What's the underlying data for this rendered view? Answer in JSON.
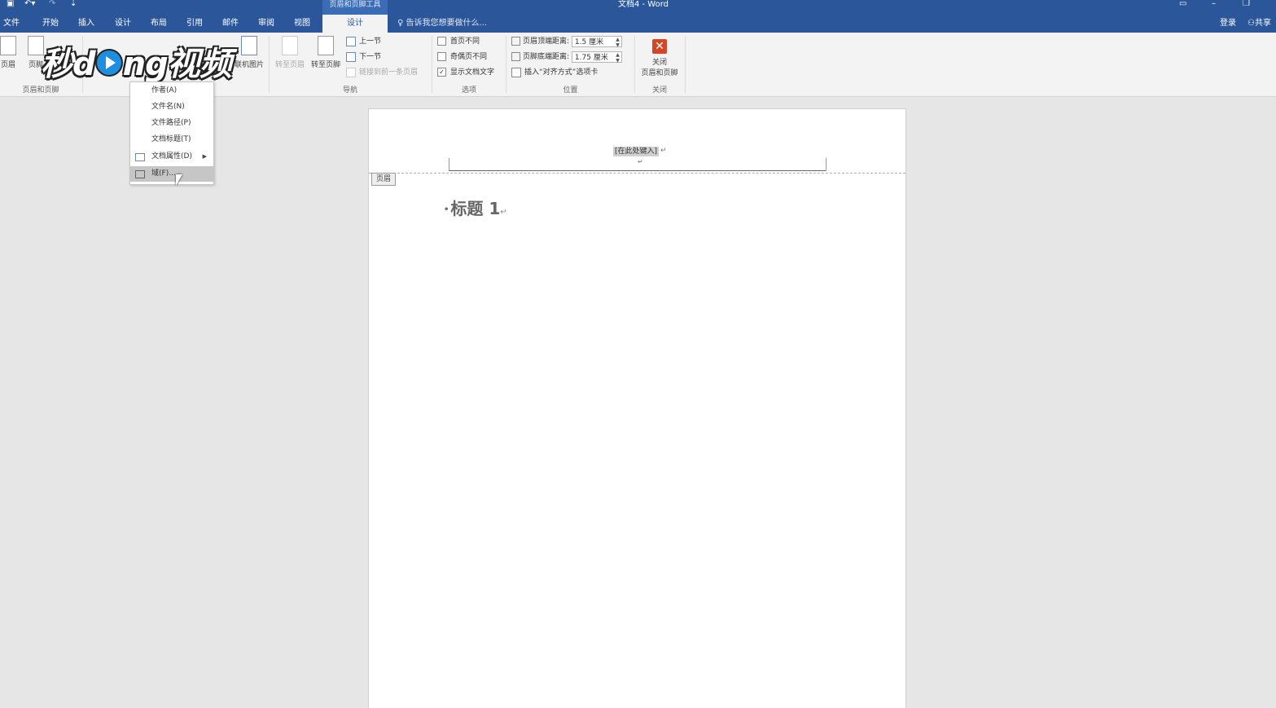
{
  "window": {
    "title": "文档4 - Word",
    "context_tab_group": "页眉和页脚工具",
    "qat": {
      "save_icon": "save-icon",
      "undo_icon": "undo-icon",
      "redo_icon": "redo-icon",
      "customize_icon": "customize-qat-icon"
    }
  },
  "tabs": [
    {
      "label": "文件"
    },
    {
      "label": "开始"
    },
    {
      "label": "插入"
    },
    {
      "label": "设计"
    },
    {
      "label": "布局"
    },
    {
      "label": "引用"
    },
    {
      "label": "邮件"
    },
    {
      "label": "审阅"
    },
    {
      "label": "视图"
    },
    {
      "label": "设计",
      "active": true
    }
  ],
  "tell_me": "告诉我您想要做什么...",
  "signin": "登录",
  "share": "共享",
  "ribbon": {
    "group_header_footer": {
      "label": "页眉和页脚",
      "header": "页眉",
      "footer": "页脚"
    },
    "online_pictures": "联机图片",
    "navigation": {
      "label": "导航",
      "goto_header": "转至页眉",
      "goto_footer": "转至页脚",
      "prev": "上一节",
      "next": "下一节",
      "link_prev": "链接到前一条页眉"
    },
    "options": {
      "label": "选项",
      "diff_first": "首页不同",
      "diff_odd_even": "奇偶页不同",
      "show_text": "显示文档文字",
      "show_text_checked": true
    },
    "position": {
      "label": "位置",
      "header_top_label": "页眉顶端距离:",
      "header_top_value": "1.5 厘米",
      "footer_bottom_label": "页脚底端距离:",
      "footer_bottom_value": "1.75 厘米",
      "insert_align_tab": "插入“对齐方式”选项卡"
    },
    "close": {
      "label": "关闭",
      "button_line1": "关闭",
      "button_line2": "页眉和页脚"
    }
  },
  "watermark": {
    "text": "秒d",
    "text2": "ng视频"
  },
  "dropdown": {
    "items": [
      {
        "label": "作者(A)"
      },
      {
        "label": "文件名(N)"
      },
      {
        "label": "文件路径(P)"
      },
      {
        "label": "文档标题(T)"
      },
      {
        "label": "文档属性(D)",
        "submenu": true
      },
      {
        "label": "域(F)...",
        "hover": true
      }
    ]
  },
  "document": {
    "header_placeholder": "[在此处键入]",
    "header_tag": "页眉",
    "heading": "标题 1"
  },
  "colors": {
    "accent": "#2b579a",
    "close_red": "#d24726"
  }
}
